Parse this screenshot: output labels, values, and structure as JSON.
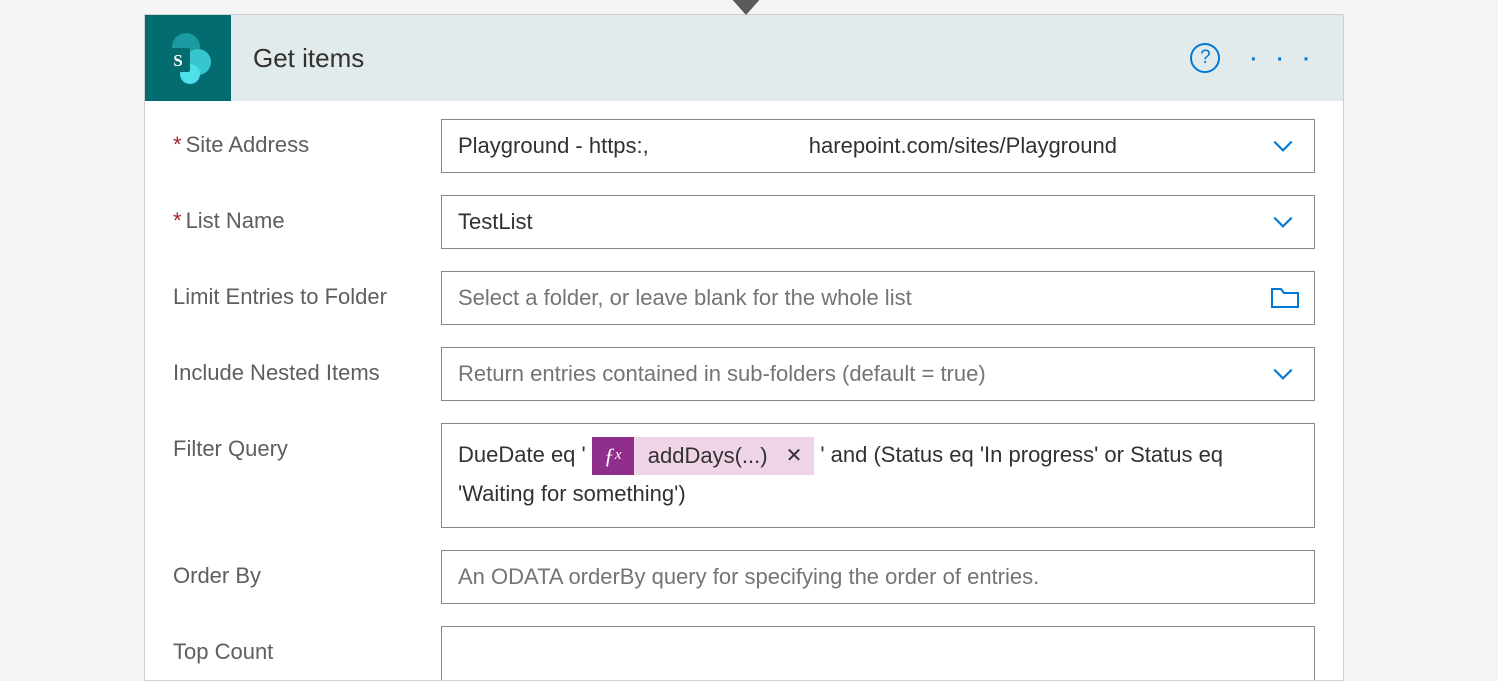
{
  "header": {
    "title": "Get items"
  },
  "fields": {
    "site_address": {
      "label": "Site Address",
      "required": true,
      "value_pre": "Playground - https:,",
      "value_post": "harepoint.com/sites/Playground"
    },
    "list_name": {
      "label": "List Name",
      "required": true,
      "value": "TestList"
    },
    "limit_folder": {
      "label": "Limit Entries to Folder",
      "placeholder": "Select a folder, or leave blank for the whole list"
    },
    "nested_items": {
      "label": "Include Nested Items",
      "placeholder": "Return entries contained in sub-folders (default = true)"
    },
    "filter_query": {
      "label": "Filter Query",
      "before_token": "DueDate eq '",
      "token_label": "addDays(...)",
      "after_token": "' and (Status eq 'In progress' or Status eq 'Waiting for something')"
    },
    "order_by": {
      "label": "Order By",
      "placeholder": "An ODATA orderBy query for specifying the order of entries."
    },
    "top_count": {
      "label": "Top Count"
    }
  }
}
